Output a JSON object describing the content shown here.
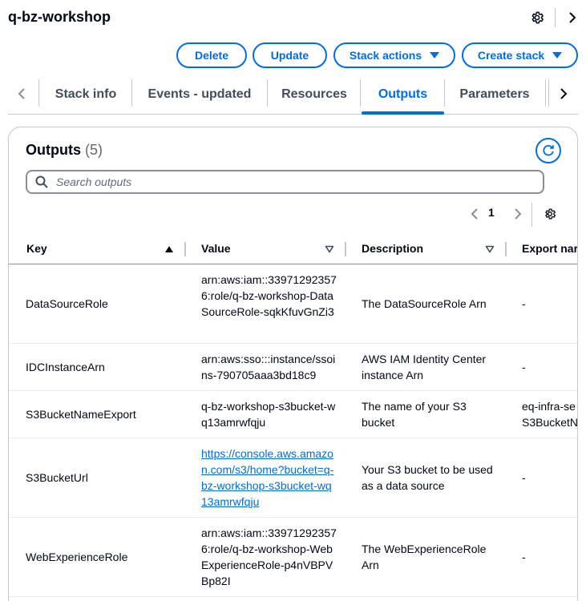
{
  "header": {
    "title": "q-bz-workshop"
  },
  "actions": {
    "delete_label": "Delete",
    "update_label": "Update",
    "stack_actions_label": "Stack actions",
    "create_stack_label": "Create stack"
  },
  "tabs": [
    {
      "label": "Stack info"
    },
    {
      "label": "Events - updated"
    },
    {
      "label": "Resources"
    },
    {
      "label": "Outputs"
    },
    {
      "label": "Parameters"
    }
  ],
  "outputs": {
    "title": "Outputs",
    "count": "(5)",
    "search_placeholder": "Search outputs",
    "page": "1",
    "columns": {
      "key": "Key",
      "value": "Value",
      "description": "Description",
      "export": "Export nar"
    },
    "rows": [
      {
        "key": "DataSourceRole",
        "value": "arn:aws:iam::339712923576:role/q-bz-workshop-DataSourceRole-sqkKfuvGnZi3",
        "description": "The DataSourceRole Arn",
        "export": "-"
      },
      {
        "key": "IDCInstanceArn",
        "value": "arn:aws:sso:::instance/ssoins-790705aaa3bd18c9",
        "description": "AWS IAM Identity Center instance Arn",
        "export": "-"
      },
      {
        "key": "S3BucketNameExport",
        "value": "q-bz-workshop-s3bucket-wq13amrwfqju",
        "description": "The name of your S3 bucket",
        "export": "eq-infra-se\nS3BucketN"
      },
      {
        "key": "S3BucketUrl",
        "value": "https://console.aws.amazon.com/s3/home?bucket=q-bz-workshop-s3bucket-wq13amrwfqju",
        "description": "Your S3 bucket to be used as a data source",
        "export": "-"
      },
      {
        "key": "WebExperienceRole",
        "value": "arn:aws:iam::339712923576:role/q-bz-workshop-WebExperienceRole-p4nVBPVBp82I",
        "description": "The WebExperienceRole Arn",
        "export": "-"
      }
    ]
  },
  "colors": {
    "accent": "#006ce0",
    "text": "#000716",
    "border": "#c6c6cd"
  }
}
